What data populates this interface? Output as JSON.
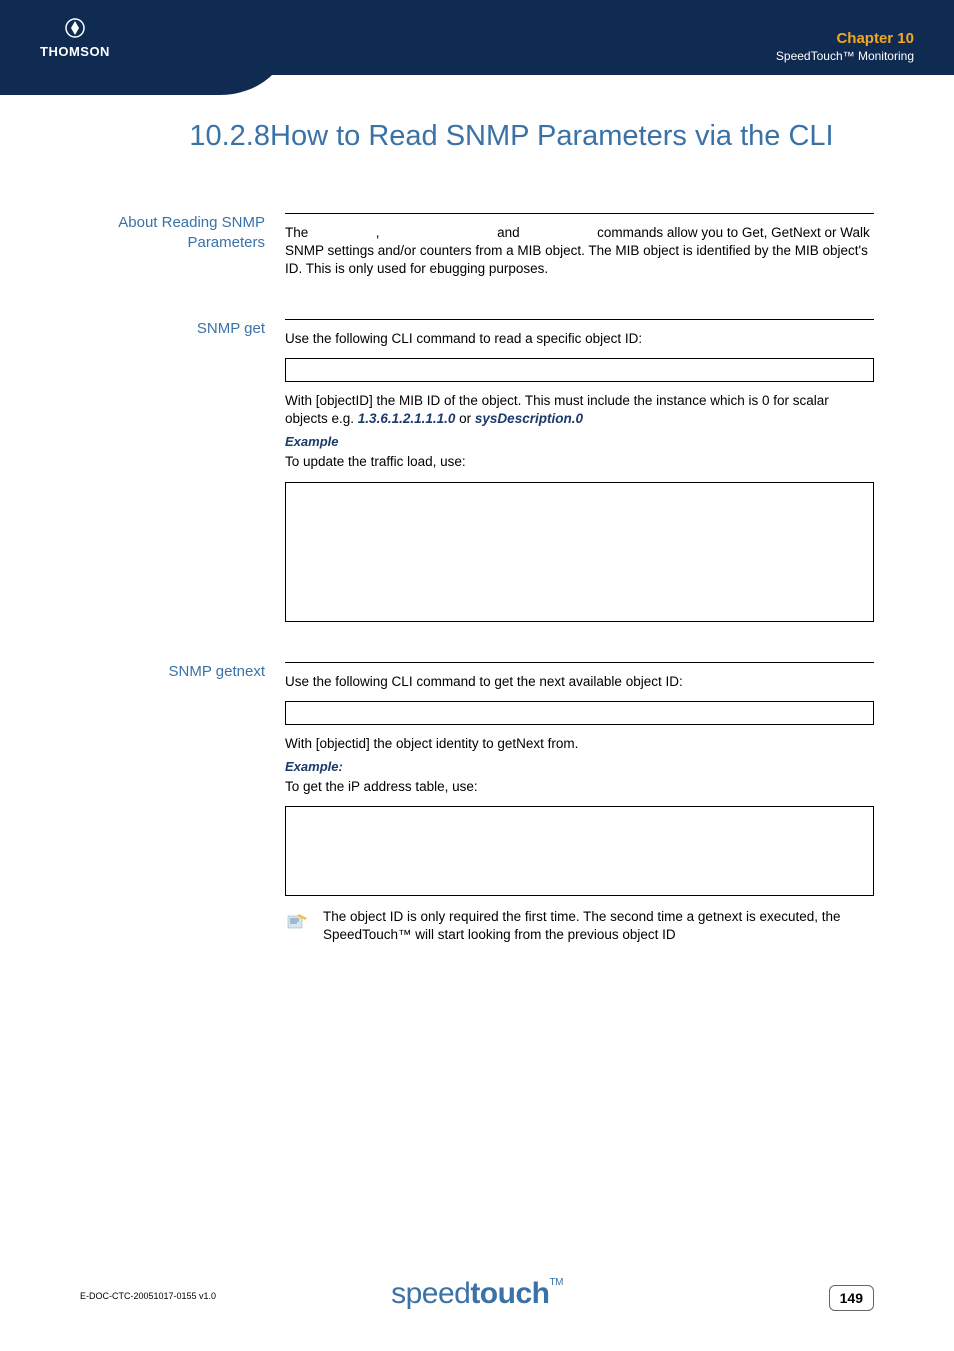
{
  "header": {
    "logo_text": "THOMSON",
    "chapter_title": "Chapter 10",
    "chapter_subtitle": "SpeedTouch™ Monitoring"
  },
  "section": {
    "number": "10.2.8",
    "title": "How to Read SNMP Parameters via the CLI"
  },
  "blocks": {
    "about": {
      "label": "About Reading SNMP Parameters",
      "text_a": "The ",
      "text_b": ", ",
      "text_c": " and ",
      "text_d": " commands allow you to Get, GetNext or Walk SNMP settings and/or counters from a MIB object. The MIB object is identified by the MIB object's ID. This is only used for ebugging purposes."
    },
    "get": {
      "label": "SNMP get",
      "intro": "Use the following CLI command to read a specific object ID:",
      "after_box1_a": "With [objectID] the MIB ID of the object. This must include the instance which is 0 for scalar objects e.g. ",
      "oid1": "1.3.6.1.2.1.1.1.0",
      "or": " or ",
      "oid2": "sysDescription.0",
      "example_label": "Example",
      "example_text": "To update the traffic load, use:"
    },
    "getnext": {
      "label": "SNMP getnext",
      "intro": "Use the following CLI command to get the next available object ID:",
      "after_box1": "With [objectid] the object identity to getNext from.",
      "example_label": "Example:",
      "example_text": "To get the iP address table, use:",
      "note": "The object ID is only required the first time. The second time a getnext is executed, the SpeedTouch™ will start looking from the previous object ID"
    }
  },
  "footer": {
    "doc_ref": "E-DOC-CTC-20051017-0155 v1.0",
    "brand_a": "speed",
    "brand_b": "touch",
    "tm": "TM",
    "page": "149"
  }
}
